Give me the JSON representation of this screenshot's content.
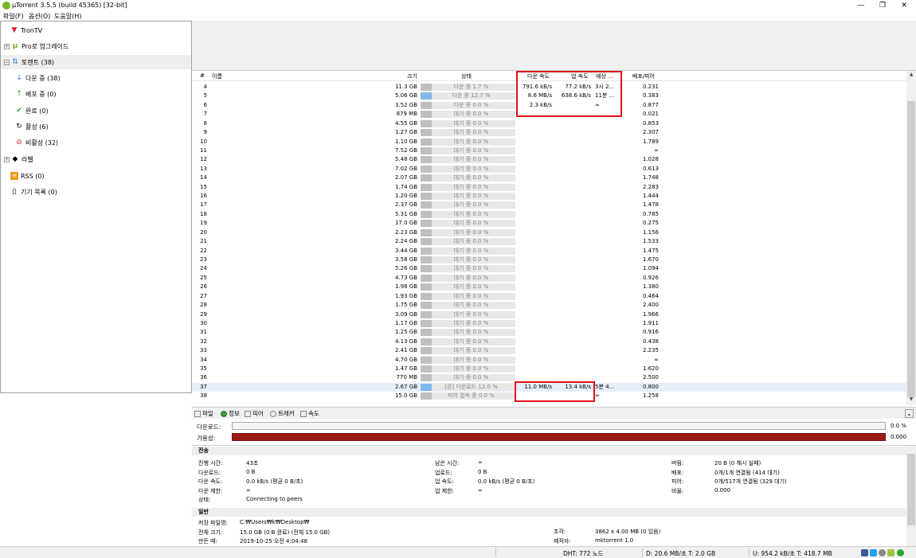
{
  "window": {
    "title": "µTorrent 3.5.5  (build 45365) [32-bit]",
    "minimize": "—",
    "maximize": "❐",
    "close": "✕"
  },
  "menu": [
    "파일(F)",
    "옵션(O)",
    "도움말(H)"
  ],
  "sidebar": [
    {
      "label": "TronTV",
      "icon": "trontv-icon"
    },
    {
      "label": "Pro로 업그레이드",
      "icon": "utorrent-pro-icon"
    },
    {
      "label": "토렌트 (38)",
      "icon": "torrents-icon"
    },
    {
      "label": "다운 중 (38)",
      "icon": "download-arrow-icon"
    },
    {
      "label": "배포 중 (0)",
      "icon": "upload-arrow-icon"
    },
    {
      "label": "완료 (0)",
      "icon": "checkmark-icon"
    },
    {
      "label": "활성 (6)",
      "icon": "refresh-icon"
    },
    {
      "label": "비활성 (32)",
      "icon": "inactive-icon"
    },
    {
      "label": "라벨",
      "icon": "label-tag-icon"
    },
    {
      "label": "RSS (0)",
      "icon": "rss-icon"
    },
    {
      "label": "기기 목록 (0)",
      "icon": "device-icon"
    }
  ],
  "columns": {
    "num": "#",
    "name": "이름",
    "size": "크기",
    "status": "상태",
    "down": "다운 속도",
    "up": "업 속도",
    "eta": "예상 ...",
    "ratio": "배포/피어"
  },
  "rows": [
    {
      "n": "4",
      "size": "11.3 GB",
      "status": "다운 중 1.7 %",
      "down": "791.6 kB/s",
      "up": "77.2 kB/s",
      "eta": "3시 2...",
      "ratio": "0.231",
      "progress": 0.017
    },
    {
      "n": "5",
      "size": "5.06 GB",
      "status": "다운 중 12.7 %",
      "down": "8.6 MB/s",
      "up": "638.6 kB/s",
      "eta": "11분 ...",
      "ratio": "0.383",
      "progress": 0.127
    },
    {
      "n": "6",
      "size": "3.52 GB",
      "status": "다운 중 0.0 %",
      "down": "2.3 kB/s",
      "up": "",
      "eta": "∞",
      "ratio": "0.877",
      "progress": 0.0
    },
    {
      "n": "7",
      "size": "879 MB",
      "status": "대기 중 0.0 %",
      "down": "",
      "up": "",
      "eta": "",
      "ratio": "0.021",
      "progress": 0.0
    },
    {
      "n": "8",
      "size": "4.55 GB",
      "status": "대기 중 0.0 %",
      "down": "",
      "up": "",
      "eta": "",
      "ratio": "0.853",
      "progress": 0.0
    },
    {
      "n": "9",
      "size": "1.27 GB",
      "status": "대기 중 0.0 %",
      "down": "",
      "up": "",
      "eta": "",
      "ratio": "2.307",
      "progress": 0.0
    },
    {
      "n": "10",
      "size": "1.10 GB",
      "status": "대기 중 0.0 %",
      "down": "",
      "up": "",
      "eta": "",
      "ratio": "1.789",
      "progress": 0.0
    },
    {
      "n": "11",
      "size": "7.52 GB",
      "status": "대기 중 0.0 %",
      "down": "",
      "up": "",
      "eta": "",
      "ratio": "∞",
      "progress": 0.0
    },
    {
      "n": "12",
      "size": "5.48 GB",
      "status": "대기 중 0.0 %",
      "down": "",
      "up": "",
      "eta": "",
      "ratio": "1.028",
      "progress": 0.0
    },
    {
      "n": "13",
      "size": "7.02 GB",
      "status": "대기 중 0.0 %",
      "down": "",
      "up": "",
      "eta": "",
      "ratio": "0.613",
      "progress": 0.0
    },
    {
      "n": "14",
      "size": "2.07 GB",
      "status": "대기 중 0.0 %",
      "down": "",
      "up": "",
      "eta": "",
      "ratio": "1.748",
      "progress": 0.0
    },
    {
      "n": "15",
      "size": "1.74 GB",
      "status": "대기 중 0.0 %",
      "down": "",
      "up": "",
      "eta": "",
      "ratio": "2.283",
      "progress": 0.0
    },
    {
      "n": "16",
      "size": "1.20 GB",
      "status": "대기 중 0.0 %",
      "down": "",
      "up": "",
      "eta": "",
      "ratio": "1.444",
      "progress": 0.0
    },
    {
      "n": "17",
      "size": "2.37 GB",
      "status": "대기 중 0.0 %",
      "down": "",
      "up": "",
      "eta": "",
      "ratio": "1.478",
      "progress": 0.0
    },
    {
      "n": "18",
      "size": "5.31 GB",
      "status": "대기 중 0.0 %",
      "down": "",
      "up": "",
      "eta": "",
      "ratio": "0.785",
      "progress": 0.0
    },
    {
      "n": "19",
      "size": "17.0 GB",
      "status": "대기 중 0.0 %",
      "down": "",
      "up": "",
      "eta": "",
      "ratio": "0.275",
      "progress": 0.0
    },
    {
      "n": "20",
      "size": "2.23 GB",
      "status": "대기 중 0.0 %",
      "down": "",
      "up": "",
      "eta": "",
      "ratio": "1.156",
      "progress": 0.0
    },
    {
      "n": "21",
      "size": "2.24 GB",
      "status": "대기 중 0.0 %",
      "down": "",
      "up": "",
      "eta": "",
      "ratio": "1.533",
      "progress": 0.0
    },
    {
      "n": "22",
      "size": "3.44 GB",
      "status": "대기 중 0.0 %",
      "down": "",
      "up": "",
      "eta": "",
      "ratio": "1.475",
      "progress": 0.0
    },
    {
      "n": "23",
      "size": "3.58 GB",
      "status": "대기 중 0.0 %",
      "down": "",
      "up": "",
      "eta": "",
      "ratio": "1.670",
      "progress": 0.0
    },
    {
      "n": "24",
      "size": "5.26 GB",
      "status": "대기 중 0.0 %",
      "down": "",
      "up": "",
      "eta": "",
      "ratio": "1.094",
      "progress": 0.0
    },
    {
      "n": "25",
      "size": "4.73 GB",
      "status": "대기 중 0.0 %",
      "down": "",
      "up": "",
      "eta": "",
      "ratio": "0.926",
      "progress": 0.0
    },
    {
      "n": "26",
      "size": "1.98 GB",
      "status": "대기 중 0.0 %",
      "down": "",
      "up": "",
      "eta": "",
      "ratio": "1.380",
      "progress": 0.0
    },
    {
      "n": "27",
      "size": "1.93 GB",
      "status": "대기 중 0.0 %",
      "down": "",
      "up": "",
      "eta": "",
      "ratio": "0.464",
      "progress": 0.0
    },
    {
      "n": "28",
      "size": "1.75 GB",
      "status": "대기 중 0.0 %",
      "down": "",
      "up": "",
      "eta": "",
      "ratio": "2.400",
      "progress": 0.0
    },
    {
      "n": "29",
      "size": "3.09 GB",
      "status": "대기 중 0.0 %",
      "down": "",
      "up": "",
      "eta": "",
      "ratio": "1.966",
      "progress": 0.0
    },
    {
      "n": "30",
      "size": "1.17 GB",
      "status": "대기 중 0.0 %",
      "down": "",
      "up": "",
      "eta": "",
      "ratio": "1.911",
      "progress": 0.0
    },
    {
      "n": "31",
      "size": "1.25 GB",
      "status": "대기 중 0.0 %",
      "down": "",
      "up": "",
      "eta": "",
      "ratio": "0.916",
      "progress": 0.0
    },
    {
      "n": "32",
      "size": "4.13 GB",
      "status": "대기 중 0.0 %",
      "down": "",
      "up": "",
      "eta": "",
      "ratio": "0.438",
      "progress": 0.0
    },
    {
      "n": "33",
      "size": "2.41 GB",
      "status": "대기 중 0.0 %",
      "down": "",
      "up": "",
      "eta": "",
      "ratio": "2.235",
      "progress": 0.0
    },
    {
      "n": "34",
      "size": "4.70 GB",
      "status": "대기 중 0.0 %",
      "down": "",
      "up": "",
      "eta": "",
      "ratio": "∞",
      "progress": 0.0
    },
    {
      "n": "35",
      "size": "1.47 GB",
      "status": "대기 중 0.0 %",
      "down": "",
      "up": "",
      "eta": "",
      "ratio": "1.620",
      "progress": 0.0
    },
    {
      "n": "36",
      "size": "770 MB",
      "status": "대기 중 0.0 %",
      "down": "",
      "up": "",
      "eta": "",
      "ratio": "2.500",
      "progress": 0.0
    },
    {
      "n": "37",
      "size": "2.67 GB",
      "status": "[강] 다운로드 12.0 %",
      "down": "11.0 MB/s",
      "up": "13.4 kB/s",
      "eta": "5분 4...",
      "ratio": "0.800",
      "progress": 0.12
    },
    {
      "n": "38",
      "size": "15.0 GB",
      "status": "피어 접속 중 0.0 %",
      "down": "",
      "up": "",
      "eta": "∞",
      "ratio": "1.258",
      "progress": 0.0
    }
  ],
  "highlight_color": "#e0121a",
  "tabs": [
    {
      "label": "파일",
      "icon": "files-icon"
    },
    {
      "label": "정보",
      "icon": "info-icon"
    },
    {
      "label": "피어",
      "icon": "peers-icon"
    },
    {
      "label": "트래커",
      "icon": "trackers-icon"
    },
    {
      "label": "속도",
      "icon": "speed-icon"
    }
  ],
  "collapse_arrow": "⌄",
  "info": {
    "download_label": "다운로드:",
    "download_value": "0.0 %",
    "download_progress": 0.0,
    "availability_label": "가용성:",
    "availability_value": "0.000",
    "availability_fill": 1.0,
    "transfer_header": "전송",
    "general_header": "일반",
    "transfer": {
      "col1": [
        {
          "k": "진행 시간:",
          "v": "43초"
        },
        {
          "k": "다운로드:",
          "v": "0 B"
        },
        {
          "k": "다운 속도:",
          "v": "0.0 kB/s (평균 0 B/초)"
        },
        {
          "k": "다운 제한:",
          "v": "∞"
        },
        {
          "k": "상태:",
          "v": "Connecting to peers"
        }
      ],
      "col2": [
        {
          "k": "남은 시간:",
          "v": "∞"
        },
        {
          "k": "업로드:",
          "v": "0 B"
        },
        {
          "k": "업 속도:",
          "v": "0.0 kB/s (평균 0 B/초)"
        },
        {
          "k": "업 제한:",
          "v": "∞"
        }
      ],
      "col3": [
        {
          "k": "버림:",
          "v": "20 B (0 해시 실패)"
        },
        {
          "k": "배포:",
          "v": "0개/1개 연결됨 (414 대기)"
        },
        {
          "k": "피어:",
          "v": "0개/517개 연결됨 (329 대기)"
        },
        {
          "k": "비율:",
          "v": "0.000"
        }
      ]
    },
    "general": {
      "col1": [
        {
          "k": "저장 파일명:",
          "v": "C:₩Users₩k₩Desktop₩"
        },
        {
          "k": "전체 크기:",
          "v": "15.0 GB (0 B 완료) (전체 15.0 GB)"
        },
        {
          "k": "만든 때:",
          "v": "2019-10-25 오전 4:04:48"
        }
      ],
      "col2": [
        {
          "k": "조각:",
          "v": "3862 x 4.00 MB (0 있음)"
        },
        {
          "k": "제작자:",
          "v": "mktorrent 1.0"
        }
      ]
    }
  },
  "statusbar": {
    "dht": "DHT: 772 노드",
    "down": "D: 20.6 MB/초 T: 2.0 GB",
    "up": "U: 954.2 kB/초 T: 418.7 MB",
    "icons": [
      "facebook-icon",
      "twitter-icon",
      "web-icon",
      "android-icon",
      "ok-status-icon"
    ]
  }
}
